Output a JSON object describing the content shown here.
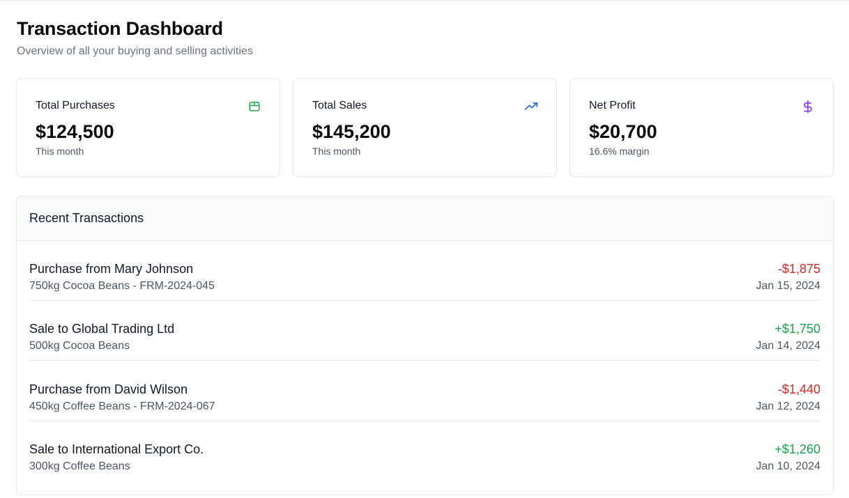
{
  "header": {
    "title": "Transaction Dashboard",
    "subtitle": "Overview of all your buying and selling activities"
  },
  "cards": [
    {
      "label": "Total Purchases",
      "value": "$124,500",
      "note": "This month",
      "icon": "package-icon",
      "color": "#16a34a"
    },
    {
      "label": "Total Sales",
      "value": "$145,200",
      "note": "This month",
      "icon": "trending-up-icon",
      "color": "#2563eb"
    },
    {
      "label": "Net Profit",
      "value": "$20,700",
      "note": "16.6% margin",
      "icon": "dollar-icon",
      "color": "#9333ea"
    }
  ],
  "transactions": {
    "title": "Recent Transactions",
    "items": [
      {
        "title": "Purchase from Mary Johnson",
        "detail": "750kg Cocoa Beans - FRM-2024-045",
        "amount": "-$1,875",
        "date": "Jan 15, 2024",
        "type": "purchase"
      },
      {
        "title": "Sale to Global Trading Ltd",
        "detail": "500kg Cocoa Beans",
        "amount": "+$1,750",
        "date": "Jan 14, 2024",
        "type": "sale"
      },
      {
        "title": "Purchase from David Wilson",
        "detail": "450kg Coffee Beans - FRM-2024-067",
        "amount": "-$1,440",
        "date": "Jan 12, 2024",
        "type": "purchase"
      },
      {
        "title": "Sale to International Export Co.",
        "detail": "300kg Coffee Beans",
        "amount": "+$1,260",
        "date": "Jan 10, 2024",
        "type": "sale"
      }
    ]
  },
  "colors": {
    "negative": "#dc2626",
    "positive": "#16a34a"
  }
}
